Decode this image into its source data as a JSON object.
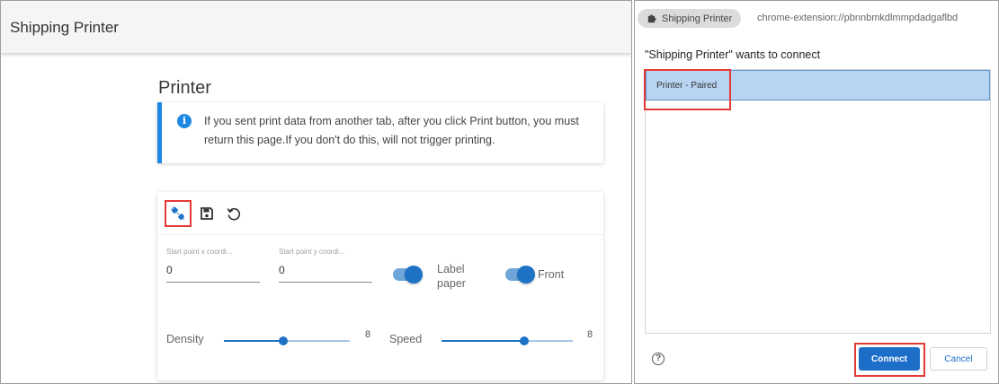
{
  "app": {
    "title": "Shipping Printer",
    "section_title": "Printer",
    "alert": {
      "icon": "info-icon",
      "message": "If you sent print data from another tab, after you click Print button, you must return this page.If you don't do this, will not trigger printing."
    },
    "toolbar": {
      "buttons": [
        {
          "icon": "connect-plug-icon",
          "highlighted": true
        },
        {
          "icon": "save-icon",
          "highlighted": false
        },
        {
          "icon": "reset-icon",
          "highlighted": false
        }
      ]
    },
    "fields": {
      "start_x": {
        "label": "Start point x coordi...",
        "value": "0"
      },
      "start_y": {
        "label": "Start point y coordi...",
        "value": "0"
      }
    },
    "switches": {
      "label_paper": {
        "label": "Label paper",
        "on": true
      },
      "front": {
        "label": "Front",
        "on": true
      }
    },
    "sliders": {
      "density": {
        "label": "Density",
        "value": "8",
        "fraction": 0.47
      },
      "speed": {
        "label": "Speed",
        "value": "8",
        "fraction": 0.63
      }
    },
    "accent_color": "#1e73c6",
    "highlight_color": "#e53935"
  },
  "dialog": {
    "chip_icon": "puzzle-icon",
    "chip_label": "Shipping Printer",
    "url": "chrome-extension://pbnnbmkdlmmpdadgaflbd",
    "prompt": "\"Shipping Printer\" wants to connect",
    "devices": [
      "Printer - Paired"
    ],
    "help_icon": "help-icon",
    "connect_label": "Connect",
    "cancel_label": "Cancel",
    "button_color": "#1d6ec9"
  }
}
